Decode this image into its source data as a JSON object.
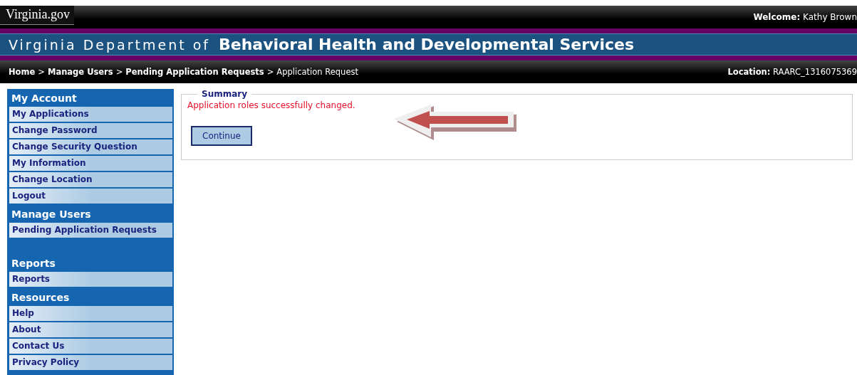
{
  "header": {
    "logo": "Virginia.gov",
    "welcome_label": "Welcome:",
    "welcome_user": "Kathy Brown"
  },
  "banner": {
    "prefix": "Virginia Department of",
    "title": "Behavioral Health and Developmental Services"
  },
  "breadcrumb": {
    "links": [
      "Home",
      "Manage Users",
      "Pending Application Requests"
    ],
    "separator": ">",
    "current": "Application Request",
    "location_label": "Location:",
    "location_value": "RAARC_1316075369"
  },
  "sidebar": [
    {
      "title": "My Account",
      "items": [
        "My Applications",
        "Change Password",
        "Change Security Question",
        "My Information",
        "Change Location",
        "Logout"
      ]
    },
    {
      "title": "Manage Users",
      "items": [
        "Pending Application Requests"
      ]
    },
    {
      "title": "Reports",
      "items": [
        "Reports"
      ]
    },
    {
      "title": "Resources",
      "items": [
        "Help",
        "About",
        "Contact Us",
        "Privacy Policy"
      ]
    }
  ],
  "summary": {
    "legend": "Summary",
    "message": "Application roles successfully changed.",
    "button": "Continue"
  }
}
